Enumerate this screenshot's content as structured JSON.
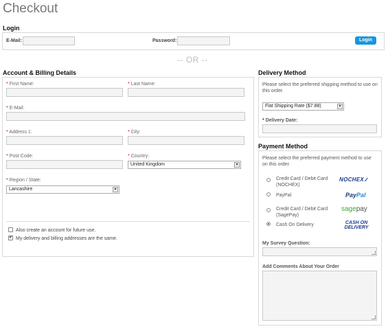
{
  "page": {
    "title": "Checkout",
    "or_text": "-- OR --"
  },
  "login": {
    "heading": "Login",
    "email_label": "E-Mail:",
    "password_label": "Password:",
    "button": "Login"
  },
  "account": {
    "heading": "Account & Billing Details",
    "first_name": "First Name:",
    "last_name": "Last Name:",
    "email": "E-Mail:",
    "address1": "Address 1:",
    "city": "City:",
    "postcode": "Post Code:",
    "country_label": "Country:",
    "country_value": "United Kingdom",
    "region_label": "Region / State:",
    "region_value": "Lancashire",
    "required_mark": "*",
    "checkbox_create": "Also create an account for future use.",
    "checkbox_create_checked": false,
    "checkbox_same": "My delivery and billing addresses are the same.",
    "checkbox_same_checked": true
  },
  "delivery": {
    "heading": "Delivery Method",
    "desc": "Please select the preferred shipping method to use on this order.",
    "method_value": "Flat Shipping Rate  ($7.88)",
    "date_label": "Delivery Date:"
  },
  "payment": {
    "heading": "Payment Method",
    "desc": "Please select the preferred payment method to use on this order.",
    "options": [
      {
        "label": "Credit Card / Debit Card (NOCHEX)",
        "logo": "NOCHEX",
        "selected": false
      },
      {
        "label": "PayPal",
        "logo_part1": "Pay",
        "logo_part2": "Pal",
        "selected": false
      },
      {
        "label": "Credit Card / Debit Card (SagePay)",
        "logo_part1": "sage",
        "logo_part2": "pay",
        "selected": false
      },
      {
        "label": "Cash On Delivery",
        "logo_line1": "CASH ON",
        "logo_line2": "DELIVERY",
        "selected": true
      }
    ],
    "survey_label": "My Survey Question:",
    "comments_label": "Add Comments About Your Order"
  },
  "colors": {
    "accent": "#1a95dd",
    "required": "#dd0000",
    "border": "#d8d8d8"
  }
}
